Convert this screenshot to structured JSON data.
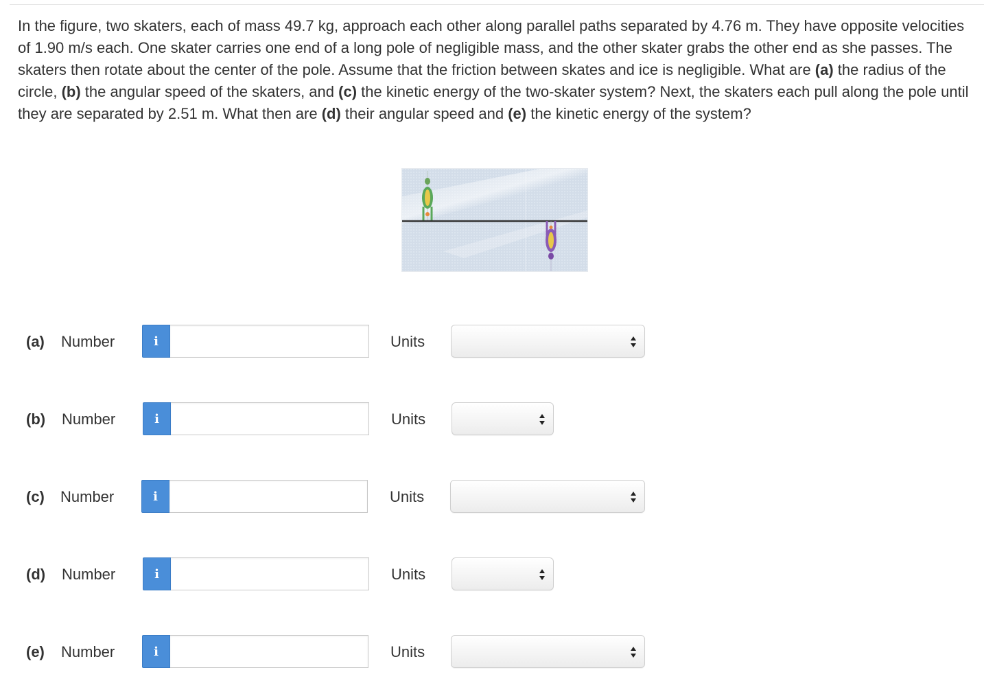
{
  "question": {
    "s1": "In the figure, two skaters, each of mass 49.7 kg, approach each other along parallel paths separated by 4.76 m. They have opposite velocities of 1.90 m/s each. One skater carries one end of a long pole of negligible mass, and the other skater grabs the other end as she passes. The skaters then rotate about the center of the pole. Assume that the friction between skates and ice is negligible. What are ",
    "a": "(a)",
    "s2": " the radius of the circle, ",
    "b": "(b)",
    "s3": " the angular speed of the skaters, and ",
    "c": "(c)",
    "s4": " the kinetic energy of the two-skater system? Next, the skaters each pull along the pole until they are separated by 2.51 m. What then are ",
    "d": "(d)",
    "s5": " their angular speed and ",
    "e": "(e)",
    "s6": " the kinetic energy of the system?"
  },
  "colors": {
    "info_button": "#4a8ed9",
    "ice": "#d3dde9",
    "pole": "#333333",
    "skater1": "#5aa85a",
    "skater2": "#8a5bb5"
  },
  "parts": [
    {
      "letter": "(a)",
      "number_label": "Number",
      "info_icon": "i",
      "value": "",
      "units_label": "Units",
      "units_selected": ""
    },
    {
      "letter": "(b)",
      "number_label": "Number",
      "info_icon": "i",
      "value": "",
      "units_label": "Units",
      "units_selected": ""
    },
    {
      "letter": "(c)",
      "number_label": "Number",
      "info_icon": "i",
      "value": "",
      "units_label": "Units",
      "units_selected": ""
    },
    {
      "letter": "(d)",
      "number_label": "Number",
      "info_icon": "i",
      "value": "",
      "units_label": "Units",
      "units_selected": ""
    },
    {
      "letter": "(e)",
      "number_label": "Number",
      "info_icon": "i",
      "value": "",
      "units_label": "Units",
      "units_selected": ""
    }
  ]
}
